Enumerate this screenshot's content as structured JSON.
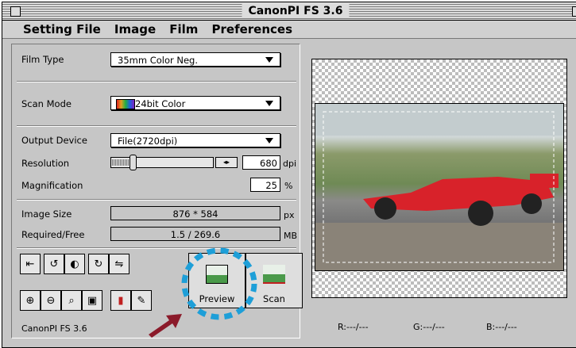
{
  "window": {
    "title": "CanonPI FS 3.6",
    "status_text": "CanonPI FS 3.6"
  },
  "menu": [
    "Setting File",
    "Image",
    "Film",
    "Preferences"
  ],
  "film_type": {
    "label": "Film Type",
    "value": "35mm Color Neg."
  },
  "scan_mode": {
    "label": "Scan Mode",
    "value": "24bit Color"
  },
  "output_device": {
    "label": "Output Device",
    "value": "File(2720dpi)"
  },
  "resolution": {
    "label": "Resolution",
    "value": "680",
    "unit": "dpi",
    "slider_fraction": 0.2
  },
  "magnification": {
    "label": "Magnification",
    "value": "25",
    "unit": "%"
  },
  "image_size": {
    "label": "Image Size",
    "value": "876 * 584",
    "unit": "px"
  },
  "required_free": {
    "label": "Required/Free",
    "value": "1.5 / 269.6",
    "unit": "MB"
  },
  "buttons": {
    "preview": "Preview",
    "scan": "Scan"
  },
  "readout": {
    "r": "R:---/---",
    "g": "G:---/---",
    "b": "B:---/---"
  },
  "colors": {
    "highlight": "#1e9fd8",
    "arrow": "#8b1a2a",
    "car": "#d8222a"
  }
}
